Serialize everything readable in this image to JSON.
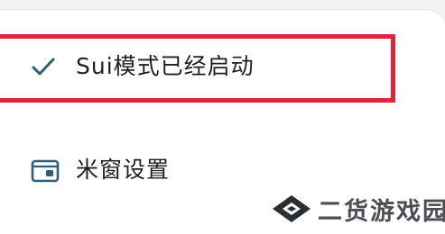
{
  "menu": {
    "sui_mode": {
      "label": "Sui模式已经启动",
      "checked": true,
      "icon": "checkmark-icon"
    },
    "window_settings": {
      "label": "米窗设置",
      "icon": "window-icon"
    }
  },
  "watermark": {
    "text": "二货游戏园",
    "icon": "diamond-logo-icon"
  },
  "colors": {
    "highlight": "#e0243a",
    "icon_accent": "#2f5d7a",
    "text": "#1d1f24"
  }
}
